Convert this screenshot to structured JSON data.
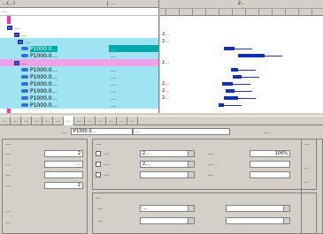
{
  "tree": {
    "header_col1": "…(…)",
    "header_col2": "…",
    "sub_col1": "…",
    "rows": [
      {
        "indent": 2,
        "icon": "folder",
        "label": "…",
        "value": "",
        "bg": "#ffffff",
        "label_bg": ""
      },
      {
        "indent": 4,
        "icon": "folder",
        "label": "…",
        "value": "",
        "bg": "#ffffff",
        "label_bg": ""
      },
      {
        "indent": 5,
        "icon": "folder",
        "label": "…",
        "value": "",
        "bg": "#a0e4f4",
        "label_bg": ""
      },
      {
        "indent": 6,
        "icon": "activity",
        "label": "P1000.0…",
        "value": "…",
        "bg": "#a0e4f4",
        "label_bg": "#00a8a8"
      },
      {
        "indent": 6,
        "icon": "activity",
        "label": "P1000.0…",
        "value": "…",
        "bg": "#a0e4f4",
        "label_bg": ""
      },
      {
        "indent": 4,
        "icon": "folder",
        "label": "…",
        "value": "",
        "bg": "#f0a0e8",
        "label_bg": ""
      },
      {
        "indent": 6,
        "icon": "activity",
        "label": "P1000.0…",
        "value": "…",
        "bg": "#a0e4f4",
        "label_bg": ""
      },
      {
        "indent": 6,
        "icon": "activity",
        "label": "P1000.0…",
        "value": "…",
        "bg": "#a0e4f4",
        "label_bg": ""
      },
      {
        "indent": 6,
        "icon": "activity",
        "label": "P1000.0…",
        "value": "…",
        "bg": "#a0e4f4",
        "label_bg": ""
      },
      {
        "indent": 6,
        "icon": "activity",
        "label": "P1000.0…",
        "value": "…",
        "bg": "#a0e4f4",
        "label_bg": ""
      },
      {
        "indent": 6,
        "icon": "activity",
        "label": "P1000.0…",
        "value": "…",
        "bg": "#a0e4f4",
        "label_bg": ""
      },
      {
        "indent": 6,
        "icon": "activity",
        "label": "P1000.0…",
        "value": "…",
        "bg": "#a0e4f4",
        "label_bg": ""
      }
    ]
  },
  "gantt": {
    "year": "2…",
    "rows": [
      {
        "text": "",
        "bar": null
      },
      {
        "text": "2…",
        "bar": null
      },
      {
        "text": "2…",
        "bar": null
      },
      {
        "text": "",
        "bar": "bar"
      },
      {
        "text": "",
        "bar": "bar"
      },
      {
        "text": "2…",
        "bar": null
      },
      {
        "text": "",
        "bar": "bar"
      },
      {
        "text": "",
        "bar": "bar"
      },
      {
        "text": "2…",
        "bar": "bar"
      },
      {
        "text": "2…",
        "bar": "bar"
      },
      {
        "text": "2…",
        "bar": "bar"
      },
      {
        "text": "",
        "bar": "bar"
      }
    ]
  },
  "tabs": [
    "…",
    "…",
    "…",
    "…",
    "…",
    "…",
    "…",
    "…",
    "…",
    "…",
    "…",
    "…",
    "…"
  ],
  "activity_row": {
    "label": "…",
    "code": "P1000.0…",
    "name": "…",
    "right_label": "…"
  },
  "duration": {
    "title": "…",
    "rows": [
      {
        "label": "…",
        "value": "2"
      },
      {
        "label": "…",
        "value": "…"
      },
      {
        "label": "…",
        "value": ""
      },
      {
        "label": "…",
        "value": "2"
      }
    ],
    "status_title": "…",
    "status_row": "…"
  },
  "dates": {
    "title": "…",
    "rows": [
      {
        "label": "…",
        "value": "2…"
      },
      {
        "label": "…",
        "value": "2…"
      },
      {
        "label": "…",
        "value": ""
      }
    ],
    "right_rows": [
      {
        "label": "…",
        "value": "100%"
      },
      {
        "label": "…",
        "value": ""
      },
      {
        "label": "…",
        "value": ""
      }
    ]
  },
  "constraints": {
    "title": "…",
    "rows": [
      {
        "label": "…",
        "value": "…"
      },
      {
        "label": "…",
        "value": ""
      }
    ]
  },
  "right_panel": {
    "title": "…",
    "rows": [
      {
        "label": "…",
        "value": ""
      },
      {
        "label": "…",
        "value": ""
      }
    ]
  },
  "watermark": "…"
}
